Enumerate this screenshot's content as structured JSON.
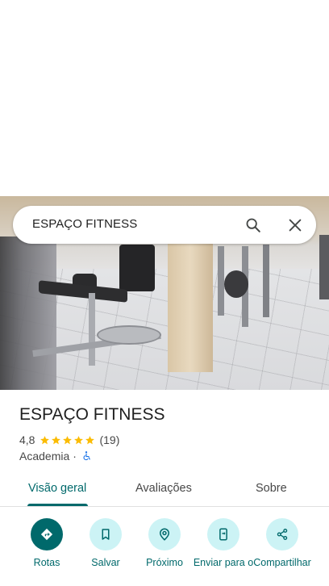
{
  "search": {
    "query": "ESPAÇO FITNESS"
  },
  "place": {
    "title": "ESPAÇO FITNESS",
    "rating": "4,8",
    "stars": 5,
    "review_count": "(19)",
    "category": "Academia",
    "separator": "·"
  },
  "tabs": [
    {
      "label": "Visão geral",
      "active": true
    },
    {
      "label": "Avaliações",
      "active": false
    },
    {
      "label": "Sobre",
      "active": false
    }
  ],
  "actions": [
    {
      "label": "Rotas",
      "icon": "directions-icon"
    },
    {
      "label": "Salvar",
      "icon": "bookmark-icon"
    },
    {
      "label": "Próximo",
      "icon": "nearby-icon"
    },
    {
      "label": "Enviar para o",
      "icon": "send-to-phone-icon"
    },
    {
      "label": "Compartilhar",
      "icon": "share-icon"
    }
  ],
  "colors": {
    "accent": "#00696b",
    "accent_light": "#ccf3f5",
    "star": "#fbbc04",
    "text_primary": "#1f1f1f",
    "text_secondary": "#474747"
  }
}
